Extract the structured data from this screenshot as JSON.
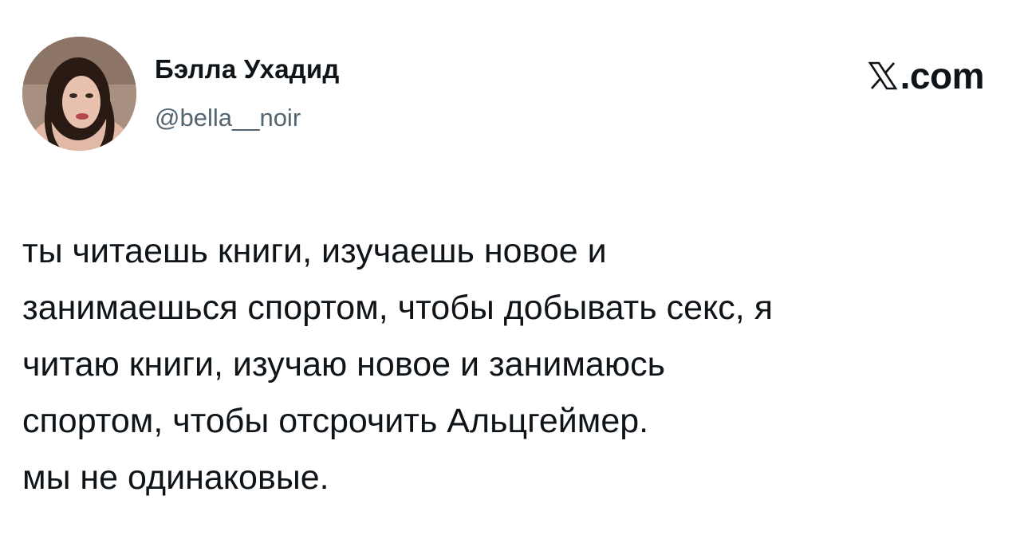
{
  "author": {
    "display_name": "Бэлла Ухадид",
    "handle": "@bella__noir",
    "avatar_icon": "profile-photo"
  },
  "brand": {
    "icon": "x-logo-icon",
    "suffix": ".com"
  },
  "tweet": {
    "lines": [
      "ты читаешь книги, изучаешь новое и",
      "занимаешься спортом, чтобы добывать секс, я",
      "читаю книги, изучаю новое и занимаюсь",
      "спортом, чтобы отсрочить Альцгеймер.",
      "мы не одинаковые."
    ]
  }
}
